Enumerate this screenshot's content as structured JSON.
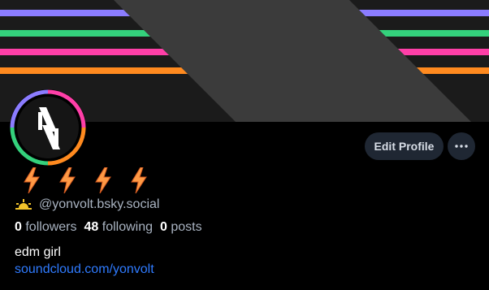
{
  "profile": {
    "handle": "@yonvolt.bsky.social",
    "followers_count": "0",
    "followers_label": "followers",
    "following_count": "48",
    "following_label": "following",
    "posts_count": "0",
    "posts_label": "posts",
    "bio": "edm girl",
    "link": "soundcloud.com/yonvolt"
  },
  "buttons": {
    "edit_profile": "Edit Profile",
    "more": "···"
  },
  "icons": {
    "emoji_badges": [
      "lightning-icon",
      "lightning-icon",
      "lightning-icon",
      "lightning-icon"
    ],
    "handle_prefix": "sun-rising-icon",
    "avatar": "yonvolt-logo"
  },
  "colors": {
    "background": "#000000",
    "accent_link": "#2f7bff",
    "banner_stripes": [
      "#8b7cff",
      "#34d17c",
      "#ff3fa8",
      "#ff8a1f"
    ]
  }
}
